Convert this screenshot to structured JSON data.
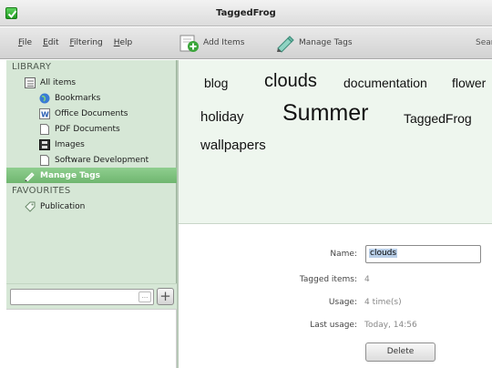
{
  "window": {
    "title": "TaggedFrog"
  },
  "menu": [
    "File",
    "Edit",
    "Filtering",
    "Help"
  ],
  "toolbar": {
    "add_items": "Add Items",
    "manage_tags": "Manage Tags",
    "search_label": "Sear"
  },
  "sidebar": {
    "library_heading": "LIBRARY",
    "all_items": "All items",
    "items": [
      "Bookmarks",
      "Office Documents",
      "PDF Documents",
      "Images",
      "Software Development"
    ],
    "manage_tags": "Manage Tags",
    "favourites_heading": "FAVOURITES",
    "favourites": [
      "Publication"
    ],
    "search_dots": "..."
  },
  "tag_cloud": {
    "tags": [
      "blog",
      "clouds",
      "documentation",
      "flower",
      "holiday",
      "Summer",
      "TaggedFrog",
      "wallpapers"
    ]
  },
  "details": {
    "name_label": "Name:",
    "name_value": "clouds",
    "tagged_label": "Tagged items:",
    "tagged_value": "4",
    "usage_label": "Usage:",
    "usage_value": "4 time(s)",
    "last_label": "Last usage:",
    "last_value": "Today, 14:56",
    "delete_label": "Delete"
  },
  "colors": {
    "sidebar_bg": "#d6e7d6",
    "selected_bg": "#7fc27f",
    "cloud_bg": "#eef6ee"
  }
}
